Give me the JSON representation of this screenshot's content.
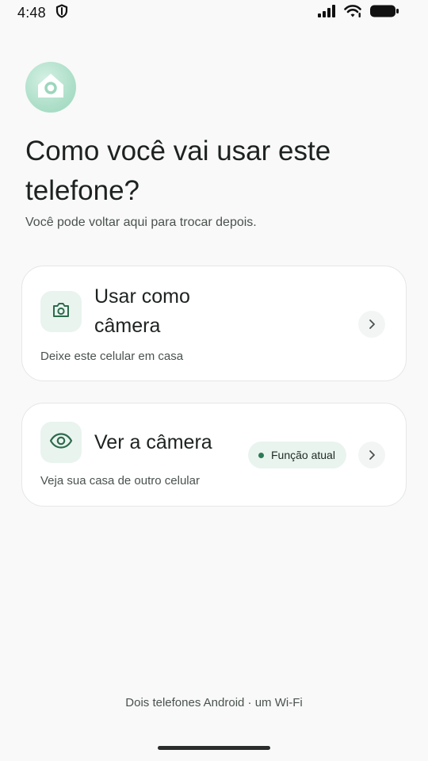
{
  "status_bar": {
    "time": "4:48",
    "left_icons": [
      "shield-icon"
    ],
    "right_icons": [
      "signal-icon",
      "wifi-icon",
      "battery-icon"
    ]
  },
  "header": {
    "logo_icon": "home-icon",
    "title": "Como você vai usar este telefone?",
    "subtitle": "Você pode voltar aqui para trocar depois."
  },
  "options": [
    {
      "icon": "camera-icon",
      "title": "Usar como câmera",
      "description": "Deixe este celular em casa"
    },
    {
      "icon": "eye-icon",
      "title": "Ver a câmera",
      "description": "Veja sua casa de outro celular",
      "badge": "Função atual"
    }
  ],
  "footer": {
    "note": "Dois telefones Android · um Wi-Fi"
  },
  "colors": {
    "accent": "#2d7a55",
    "accent_light": "#e9f4ef",
    "background": "#f8f9f8"
  }
}
